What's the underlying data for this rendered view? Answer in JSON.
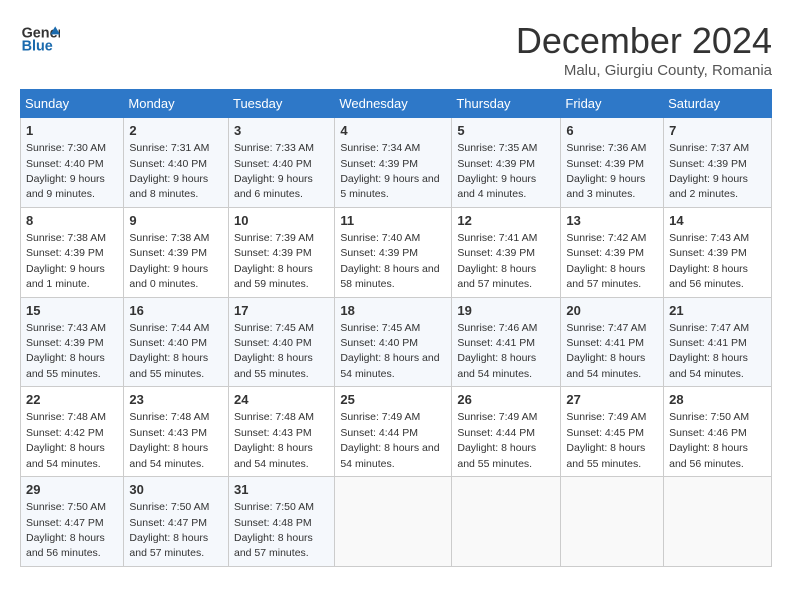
{
  "logo": {
    "line1": "General",
    "line2": "Blue"
  },
  "title": "December 2024",
  "subtitle": "Malu, Giurgiu County, Romania",
  "days_of_week": [
    "Sunday",
    "Monday",
    "Tuesday",
    "Wednesday",
    "Thursday",
    "Friday",
    "Saturday"
  ],
  "weeks": [
    [
      {
        "num": "1",
        "sunrise": "Sunrise: 7:30 AM",
        "sunset": "Sunset: 4:40 PM",
        "daylight": "Daylight: 9 hours and 9 minutes."
      },
      {
        "num": "2",
        "sunrise": "Sunrise: 7:31 AM",
        "sunset": "Sunset: 4:40 PM",
        "daylight": "Daylight: 9 hours and 8 minutes."
      },
      {
        "num": "3",
        "sunrise": "Sunrise: 7:33 AM",
        "sunset": "Sunset: 4:40 PM",
        "daylight": "Daylight: 9 hours and 6 minutes."
      },
      {
        "num": "4",
        "sunrise": "Sunrise: 7:34 AM",
        "sunset": "Sunset: 4:39 PM",
        "daylight": "Daylight: 9 hours and 5 minutes."
      },
      {
        "num": "5",
        "sunrise": "Sunrise: 7:35 AM",
        "sunset": "Sunset: 4:39 PM",
        "daylight": "Daylight: 9 hours and 4 minutes."
      },
      {
        "num": "6",
        "sunrise": "Sunrise: 7:36 AM",
        "sunset": "Sunset: 4:39 PM",
        "daylight": "Daylight: 9 hours and 3 minutes."
      },
      {
        "num": "7",
        "sunrise": "Sunrise: 7:37 AM",
        "sunset": "Sunset: 4:39 PM",
        "daylight": "Daylight: 9 hours and 2 minutes."
      }
    ],
    [
      {
        "num": "8",
        "sunrise": "Sunrise: 7:38 AM",
        "sunset": "Sunset: 4:39 PM",
        "daylight": "Daylight: 9 hours and 1 minute."
      },
      {
        "num": "9",
        "sunrise": "Sunrise: 7:38 AM",
        "sunset": "Sunset: 4:39 PM",
        "daylight": "Daylight: 9 hours and 0 minutes."
      },
      {
        "num": "10",
        "sunrise": "Sunrise: 7:39 AM",
        "sunset": "Sunset: 4:39 PM",
        "daylight": "Daylight: 8 hours and 59 minutes."
      },
      {
        "num": "11",
        "sunrise": "Sunrise: 7:40 AM",
        "sunset": "Sunset: 4:39 PM",
        "daylight": "Daylight: 8 hours and 58 minutes."
      },
      {
        "num": "12",
        "sunrise": "Sunrise: 7:41 AM",
        "sunset": "Sunset: 4:39 PM",
        "daylight": "Daylight: 8 hours and 57 minutes."
      },
      {
        "num": "13",
        "sunrise": "Sunrise: 7:42 AM",
        "sunset": "Sunset: 4:39 PM",
        "daylight": "Daylight: 8 hours and 57 minutes."
      },
      {
        "num": "14",
        "sunrise": "Sunrise: 7:43 AM",
        "sunset": "Sunset: 4:39 PM",
        "daylight": "Daylight: 8 hours and 56 minutes."
      }
    ],
    [
      {
        "num": "15",
        "sunrise": "Sunrise: 7:43 AM",
        "sunset": "Sunset: 4:39 PM",
        "daylight": "Daylight: 8 hours and 55 minutes."
      },
      {
        "num": "16",
        "sunrise": "Sunrise: 7:44 AM",
        "sunset": "Sunset: 4:40 PM",
        "daylight": "Daylight: 8 hours and 55 minutes."
      },
      {
        "num": "17",
        "sunrise": "Sunrise: 7:45 AM",
        "sunset": "Sunset: 4:40 PM",
        "daylight": "Daylight: 8 hours and 55 minutes."
      },
      {
        "num": "18",
        "sunrise": "Sunrise: 7:45 AM",
        "sunset": "Sunset: 4:40 PM",
        "daylight": "Daylight: 8 hours and 54 minutes."
      },
      {
        "num": "19",
        "sunrise": "Sunrise: 7:46 AM",
        "sunset": "Sunset: 4:41 PM",
        "daylight": "Daylight: 8 hours and 54 minutes."
      },
      {
        "num": "20",
        "sunrise": "Sunrise: 7:47 AM",
        "sunset": "Sunset: 4:41 PM",
        "daylight": "Daylight: 8 hours and 54 minutes."
      },
      {
        "num": "21",
        "sunrise": "Sunrise: 7:47 AM",
        "sunset": "Sunset: 4:41 PM",
        "daylight": "Daylight: 8 hours and 54 minutes."
      }
    ],
    [
      {
        "num": "22",
        "sunrise": "Sunrise: 7:48 AM",
        "sunset": "Sunset: 4:42 PM",
        "daylight": "Daylight: 8 hours and 54 minutes."
      },
      {
        "num": "23",
        "sunrise": "Sunrise: 7:48 AM",
        "sunset": "Sunset: 4:43 PM",
        "daylight": "Daylight: 8 hours and 54 minutes."
      },
      {
        "num": "24",
        "sunrise": "Sunrise: 7:48 AM",
        "sunset": "Sunset: 4:43 PM",
        "daylight": "Daylight: 8 hours and 54 minutes."
      },
      {
        "num": "25",
        "sunrise": "Sunrise: 7:49 AM",
        "sunset": "Sunset: 4:44 PM",
        "daylight": "Daylight: 8 hours and 54 minutes."
      },
      {
        "num": "26",
        "sunrise": "Sunrise: 7:49 AM",
        "sunset": "Sunset: 4:44 PM",
        "daylight": "Daylight: 8 hours and 55 minutes."
      },
      {
        "num": "27",
        "sunrise": "Sunrise: 7:49 AM",
        "sunset": "Sunset: 4:45 PM",
        "daylight": "Daylight: 8 hours and 55 minutes."
      },
      {
        "num": "28",
        "sunrise": "Sunrise: 7:50 AM",
        "sunset": "Sunset: 4:46 PM",
        "daylight": "Daylight: 8 hours and 56 minutes."
      }
    ],
    [
      {
        "num": "29",
        "sunrise": "Sunrise: 7:50 AM",
        "sunset": "Sunset: 4:47 PM",
        "daylight": "Daylight: 8 hours and 56 minutes."
      },
      {
        "num": "30",
        "sunrise": "Sunrise: 7:50 AM",
        "sunset": "Sunset: 4:47 PM",
        "daylight": "Daylight: 8 hours and 57 minutes."
      },
      {
        "num": "31",
        "sunrise": "Sunrise: 7:50 AM",
        "sunset": "Sunset: 4:48 PM",
        "daylight": "Daylight: 8 hours and 57 minutes."
      },
      null,
      null,
      null,
      null
    ]
  ]
}
